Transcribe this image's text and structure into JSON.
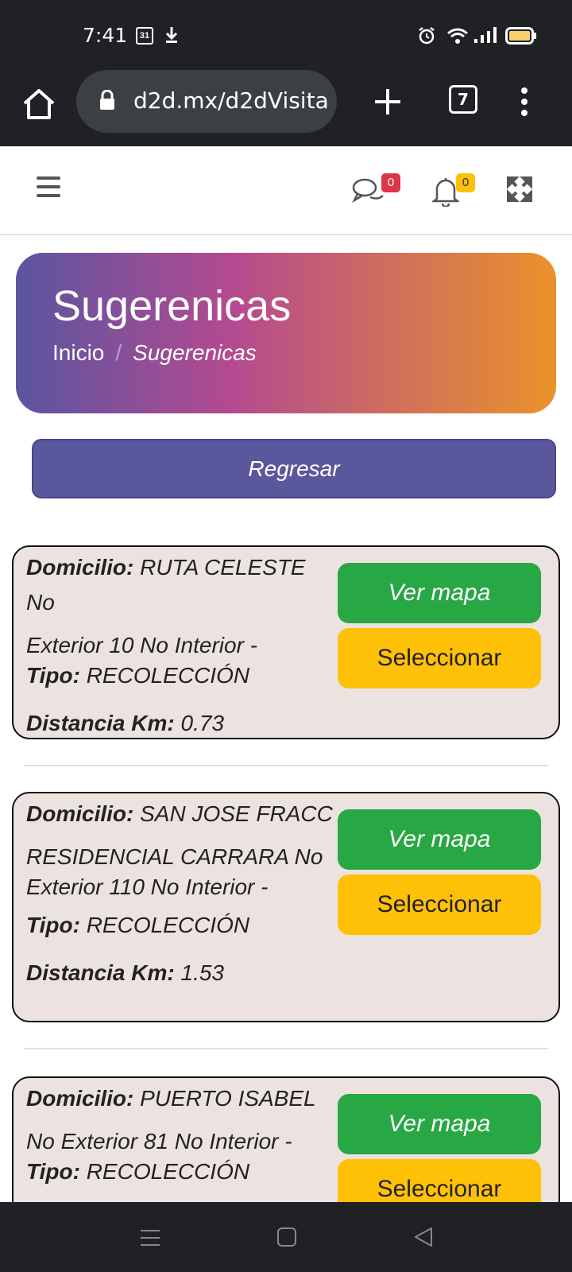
{
  "status_bar": {
    "time": "7:41",
    "calendar_day": "31"
  },
  "browser": {
    "url": "d2d.mx/d2dVisita",
    "tab_count": "7"
  },
  "header": {
    "chat_badge": "0",
    "bell_badge": "0"
  },
  "hero": {
    "title": "Sugerenicas",
    "breadcrumb_home": "Inicio",
    "breadcrumb_separator": "/",
    "breadcrumb_current": "Sugerenicas"
  },
  "back_button": "Regresar",
  "labels": {
    "domicilio": "Domicilio:",
    "tipo": "Tipo:",
    "distancia": "Distancia Km:",
    "ver_mapa": "Ver mapa",
    "seleccionar": "Seleccionar"
  },
  "cards": [
    {
      "address_line1": "RUTA CELESTE No",
      "address_line2": "Exterior 10 No Interior -",
      "address_line3": "",
      "tipo": "RECOLECCIÓN",
      "distancia": "0.73"
    },
    {
      "address_line1": "SAN JOSE FRACC",
      "address_line2": "RESIDENCIAL CARRARA No",
      "address_line3": "Exterior 110 No Interior -",
      "tipo": "RECOLECCIÓN",
      "distancia": "1.53"
    },
    {
      "address_line1": "PUERTO ISABEL",
      "address_line2": "No Exterior 81 No Interior -",
      "address_line3": "",
      "tipo": "RECOLECCIÓN",
      "distancia": ""
    }
  ]
}
